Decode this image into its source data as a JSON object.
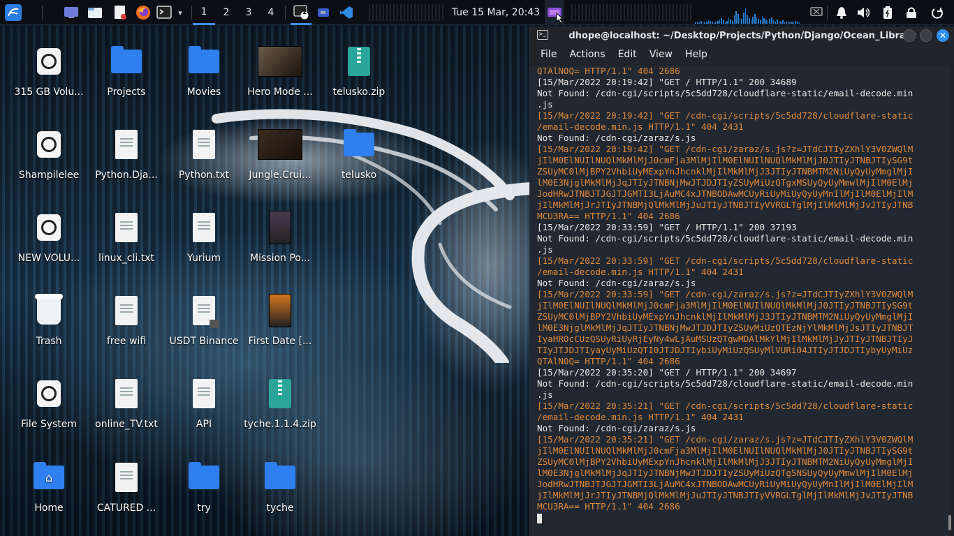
{
  "panel": {
    "workspaces": [
      "1",
      "2",
      "3",
      "4"
    ],
    "active_workspace": "1",
    "clock": "Tue 15 Mar, 20:43",
    "launcher_icons": [
      "kali-menu-icon",
      "desktop-icon",
      "file-manager-icon",
      "text-editor-icon",
      "firefox-icon",
      "terminal-icon"
    ],
    "task_badge": "2",
    "tray_icons": [
      "notifications-icon",
      "volume-icon",
      "battery-icon",
      "lock-icon",
      "power-icon"
    ]
  },
  "desktop": {
    "icons": [
      {
        "label": "315 GB Volu...",
        "kind": "drive"
      },
      {
        "label": "Projects",
        "kind": "folder"
      },
      {
        "label": "Movies",
        "kind": "folder"
      },
      {
        "label": "Hero Mode ...",
        "kind": "video"
      },
      {
        "label": "telusko.zip",
        "kind": "zip"
      },
      {
        "label": "Shampilelee",
        "kind": "drive"
      },
      {
        "label": "Python.Dja...",
        "kind": "file"
      },
      {
        "label": "Python.txt",
        "kind": "file"
      },
      {
        "label": "Jungle.Crui...",
        "kind": "video"
      },
      {
        "label": "telusko",
        "kind": "folder"
      },
      {
        "label": "NEW VOLU...",
        "kind": "drive"
      },
      {
        "label": "linux_cli.txt",
        "kind": "file"
      },
      {
        "label": "Yurium",
        "kind": "file"
      },
      {
        "label": "Mission Po...",
        "kind": "poster"
      },
      {
        "label": "Trash",
        "kind": "trash"
      },
      {
        "label": "free wifi",
        "kind": "file"
      },
      {
        "label": "USDT Binance",
        "kind": "file-locked"
      },
      {
        "label": "First Date [...",
        "kind": "poster"
      },
      {
        "label": "File System",
        "kind": "drive"
      },
      {
        "label": "online_TV.txt",
        "kind": "file"
      },
      {
        "label": "API",
        "kind": "file"
      },
      {
        "label": "tyche.1.1.4.zip",
        "kind": "zip"
      },
      {
        "label": "Home",
        "kind": "home-folder"
      },
      {
        "label": "CATURED ...",
        "kind": "file"
      },
      {
        "label": "try",
        "kind": "folder"
      },
      {
        "label": "tyche",
        "kind": "folder"
      }
    ]
  },
  "terminal": {
    "title": "dhope@localhost: ~/Desktop/Projects/Python/Django/Ocean_Library",
    "menu": [
      "File",
      "Actions",
      "Edit",
      "View",
      "Help"
    ],
    "lines": [
      {
        "t": "QTAlN0Q= HTTP/1.1\" 404 2686",
        "c": "or"
      },
      {
        "t": "[15/Mar/2022 20:19:42] \"GET / HTTP/1.1\" 200 34689",
        "c": ""
      },
      {
        "t": "Not Found: /cdn-cgi/scripts/5c5dd728/cloudflare-static/email-decode.min",
        "c": ""
      },
      {
        "t": ".js",
        "c": ""
      },
      {
        "t": "[15/Mar/2022 20:19:42] \"GET /cdn-cgi/scripts/5c5dd728/cloudflare-static",
        "c": "or"
      },
      {
        "t": "/email-decode.min.js HTTP/1.1\" 404 2431",
        "c": "or"
      },
      {
        "t": "Not Found: /cdn-cgi/zaraz/s.js",
        "c": ""
      },
      {
        "t": "[15/Mar/2022 20:19:42] \"GET /cdn-cgi/zaraz/s.js?z=JTdCJTIyZXhlY3V0ZWQlM",
        "c": "or"
      },
      {
        "t": "jIlM0ElNUIlNUQlMkMlMjJ0cmFja3MlMjIlM0ElNUIlNUQlMkMlMjJ0JTIyJTNBJTIySG9t",
        "c": "or"
      },
      {
        "t": "ZSUyMC0lMjBPY2VhbiUyMExpYnJhcnklMjIlMkMlMjJ3JTIyJTNBMTM2NiUyQyUyMmglMjI",
        "c": "or"
      },
      {
        "t": "lM0E3NjglMkMlMjJqJTIyJTNBNjMwJTJDJTIyZSUyMiUzQTgxMSUyQyUyMmwlMjIlM0ElMj",
        "c": "or"
      },
      {
        "t": "JodHRwJTNBJTJGJTJGMTI3LjAuMC4xJTNBODAwMCUyRiUyMiUyQyUyMnIlMjIlM0ElMjIlM",
        "c": "or"
      },
      {
        "t": "jIlMkMlMjJrJTIyJTNBMjQlMkMlMjJuJTIyJTNBJTIyVVRGLTglMjIlMkMlMjJvJTIyJTNB",
        "c": "or"
      },
      {
        "t": "MCU3RA== HTTP/1.1\" 404 2686",
        "c": "or"
      },
      {
        "t": "[15/Mar/2022 20:33:59] \"GET / HTTP/1.1\" 200 37193",
        "c": ""
      },
      {
        "t": "Not Found: /cdn-cgi/scripts/5c5dd728/cloudflare-static/email-decode.min",
        "c": ""
      },
      {
        "t": ".js",
        "c": ""
      },
      {
        "t": "[15/Mar/2022 20:33:59] \"GET /cdn-cgi/scripts/5c5dd728/cloudflare-static",
        "c": "or"
      },
      {
        "t": "/email-decode.min.js HTTP/1.1\" 404 2431",
        "c": "or"
      },
      {
        "t": "Not Found: /cdn-cgi/zaraz/s.js",
        "c": ""
      },
      {
        "t": "[15/Mar/2022 20:33:59] \"GET /cdn-cgi/zaraz/s.js?z=JTdCJTIyZXhlY3V0ZWQlM",
        "c": "or"
      },
      {
        "t": "jIlM0ElNUIlNUQlMkMlMjJ0cmFja3MlMjIlM0ElNUIlNUQlMkMlMjJ0JTIyJTNBJTIySG9t",
        "c": "or"
      },
      {
        "t": "ZSUyMC0lMjBPY2VhbiUyMExpYnJhcnklMjIlMkMlMjJ3JTIyJTNBMTM2NiUyQyUyMmglMjI",
        "c": "or"
      },
      {
        "t": "lM0E3NjglMkMlMjJqJTIyJTNBNjMwJTJDJTIyZSUyMiUzQTEzNjYlMkMlMjJsJTIyJTNBJT",
        "c": "or"
      },
      {
        "t": "IyaHR0cCUzQSUyRiUyRjEyNy4wLjAuMSUzQTgwMDAlMkYlMjIlMkMlMjJyJTIyJTNBJTIyJ",
        "c": "or"
      },
      {
        "t": "TIyJTJDJTIyayUyMiUzQTI0JTJDJTIybiUyMiUzQSUyMlVURi04JTIyJTJDJTIybyUyMiUz",
        "c": "or"
      },
      {
        "t": "QTAlN0Q= HTTP/1.1\" 404 2686",
        "c": "or"
      },
      {
        "t": "[15/Mar/2022 20:35:20] \"GET / HTTP/1.1\" 200 34697",
        "c": ""
      },
      {
        "t": "Not Found: /cdn-cgi/scripts/5c5dd728/cloudflare-static/email-decode.min",
        "c": ""
      },
      {
        "t": ".js",
        "c": ""
      },
      {
        "t": "[15/Mar/2022 20:35:21] \"GET /cdn-cgi/scripts/5c5dd728/cloudflare-static",
        "c": "or"
      },
      {
        "t": "/email-decode.min.js HTTP/1.1\" 404 2431",
        "c": "or"
      },
      {
        "t": "Not Found: /cdn-cgi/zaraz/s.js",
        "c": ""
      },
      {
        "t": "[15/Mar/2022 20:35:21] \"GET /cdn-cgi/zaraz/s.js?z=JTdCJTIyZXhlY3V0ZWQlM",
        "c": "or"
      },
      {
        "t": "jIlM0ElNUIlNUQlMkMlMjJ0cmFja3MlMjIlM0ElNUIlNUQlMkMlMjJ0JTIyJTNBJTIySG9t",
        "c": "or"
      },
      {
        "t": "ZSUyMC0lMjBPY2VhbiUyMExpYnJhcnklMjIlMkMlMjJ3JTIyJTNBMTM2NiUyQyUyMmglMjI",
        "c": "or"
      },
      {
        "t": "lM0E3NjglMkMlMjJqJTIyJTNBNjMwJTJDJTIyZSUyMiUzQTg5NSUyQyUyMmwlMjIlM0ElMj",
        "c": "or"
      },
      {
        "t": "JodHRwJTNBJTJGJTJGMTI3LjAuMC4xJTNBODAwMCUyRiUyMiUyQyUyMnIlMjIlM0ElMjIlM",
        "c": "or"
      },
      {
        "t": "jIlMkMlMjJrJTIyJTNBMjQlMkMlMjJuJTIyJTNBJTIyVVRGLTglMjIlMkMlMjJvJTIyJTNB",
        "c": "or"
      },
      {
        "t": "MCU3RA== HTTP/1.1\" 404 2686",
        "c": "or"
      }
    ]
  },
  "colors": {
    "accent": "#2e7ff0",
    "log_orange": "#e08a3a",
    "terminal_bg": "#222831"
  }
}
